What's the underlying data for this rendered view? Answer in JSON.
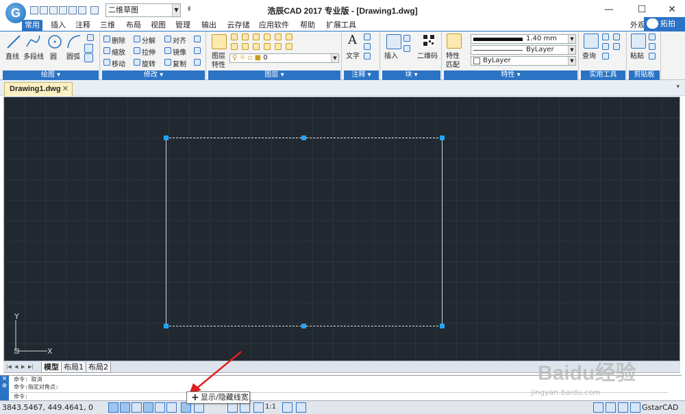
{
  "title_bar": {
    "app_logo_letter": "G",
    "title": "浩辰CAD 2017 专业版 - [Drawing1.dwg]",
    "workspace": "二维草图",
    "minimize": "—",
    "maximize": "☐",
    "close": "✕"
  },
  "ribbon_tabs": [
    "常用",
    "插入",
    "注释",
    "三维",
    "布局",
    "视图",
    "管理",
    "输出",
    "云存储",
    "应用软件",
    "帮助",
    "扩展工具"
  ],
  "extra_tab": "外观",
  "baidu_tab": "拓拍",
  "panels": {
    "draw": {
      "title": "绘图 ▾",
      "items": [
        "直线",
        "多段线",
        "圆",
        "圆弧"
      ]
    },
    "modify": {
      "title": "修改 ▾",
      "items": [
        "删除",
        "分解",
        "对齐",
        "缩放",
        "拉伸",
        "镜像",
        "移动",
        "旋转",
        "复制"
      ]
    },
    "layers": {
      "title": "图层 ▾",
      "label_top": "图层",
      "label_bottom": "特性",
      "current_layer": "0"
    },
    "annotation": {
      "title": "注释 ▾",
      "items": [
        "文字"
      ]
    },
    "block": {
      "title": "块 ▾",
      "items": [
        "插入",
        "二维码"
      ]
    },
    "properties": {
      "title": "特性 ▾",
      "match_top": "特性",
      "match_bottom": "匹配",
      "lineweight": "1.40 mm",
      "linetype": "ByLayer",
      "color": "ByLayer"
    },
    "utilities": {
      "title": "实用工具",
      "items": [
        "查询"
      ]
    },
    "clipboard": {
      "title": "剪贴板",
      "items": [
        "粘贴"
      ]
    }
  },
  "doc_tab": {
    "name": "Drawing1.dwg",
    "close": "✕"
  },
  "layout_tabs": [
    "模型",
    "布局1",
    "布局2"
  ],
  "ucs": {
    "y": "Y",
    "x": "X"
  },
  "command": {
    "history": [
      "命令: 取消",
      "命令:指定对角点:"
    ],
    "prompt": "命令:"
  },
  "tooltip": "显示/隐藏线宽",
  "status": {
    "coords": "3843.5467, 449.4641, 0",
    "scale": "1:1",
    "app_label": "GstarCAD"
  },
  "watermark": {
    "text": "Baidu经验",
    "url": "jingyan.baidu.com"
  },
  "colors": {
    "accent": "#2b73c5",
    "canvas": "#212830",
    "grip": "#1fa6ff",
    "doc_tab": "#fcefc2"
  }
}
